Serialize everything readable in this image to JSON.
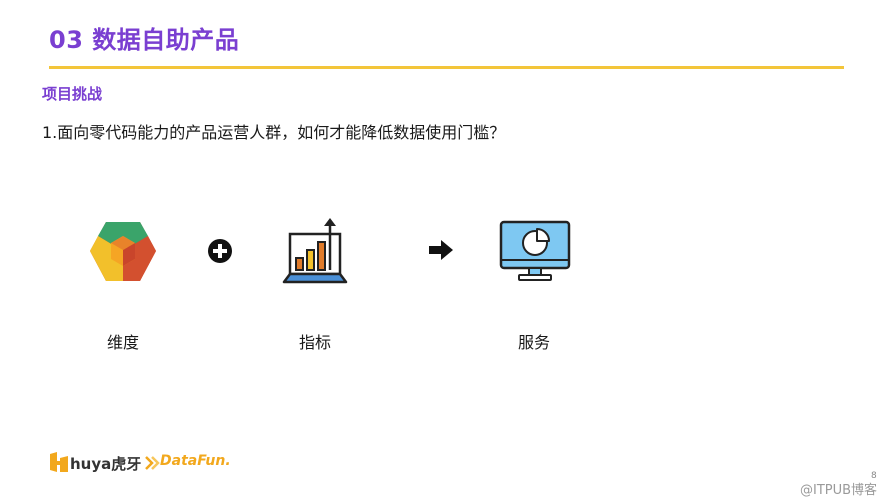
{
  "header": {
    "title": "03 数据自助产品",
    "section": "项目挑战",
    "question": "1.面向零代码能力的产品运营人群，如何才能降低数据使用门槛？"
  },
  "flow": {
    "items": [
      {
        "label": "维度",
        "icon": "cube-icon"
      },
      {
        "label": "指标",
        "icon": "bar-chart-laptop-icon"
      },
      {
        "label": "服务",
        "icon": "monitor-pie-chart-icon"
      }
    ],
    "connectors": [
      "plus-icon",
      "arrow-right-icon"
    ]
  },
  "footer": {
    "logo_huya": "huya虎牙",
    "logo_datafun": "DataFun.",
    "page_number": "8",
    "watermark": "@ITPUB博客"
  },
  "colors": {
    "title": "#7a3fd1",
    "rule": "#f3c53a",
    "datafun": "#f2a81d"
  }
}
